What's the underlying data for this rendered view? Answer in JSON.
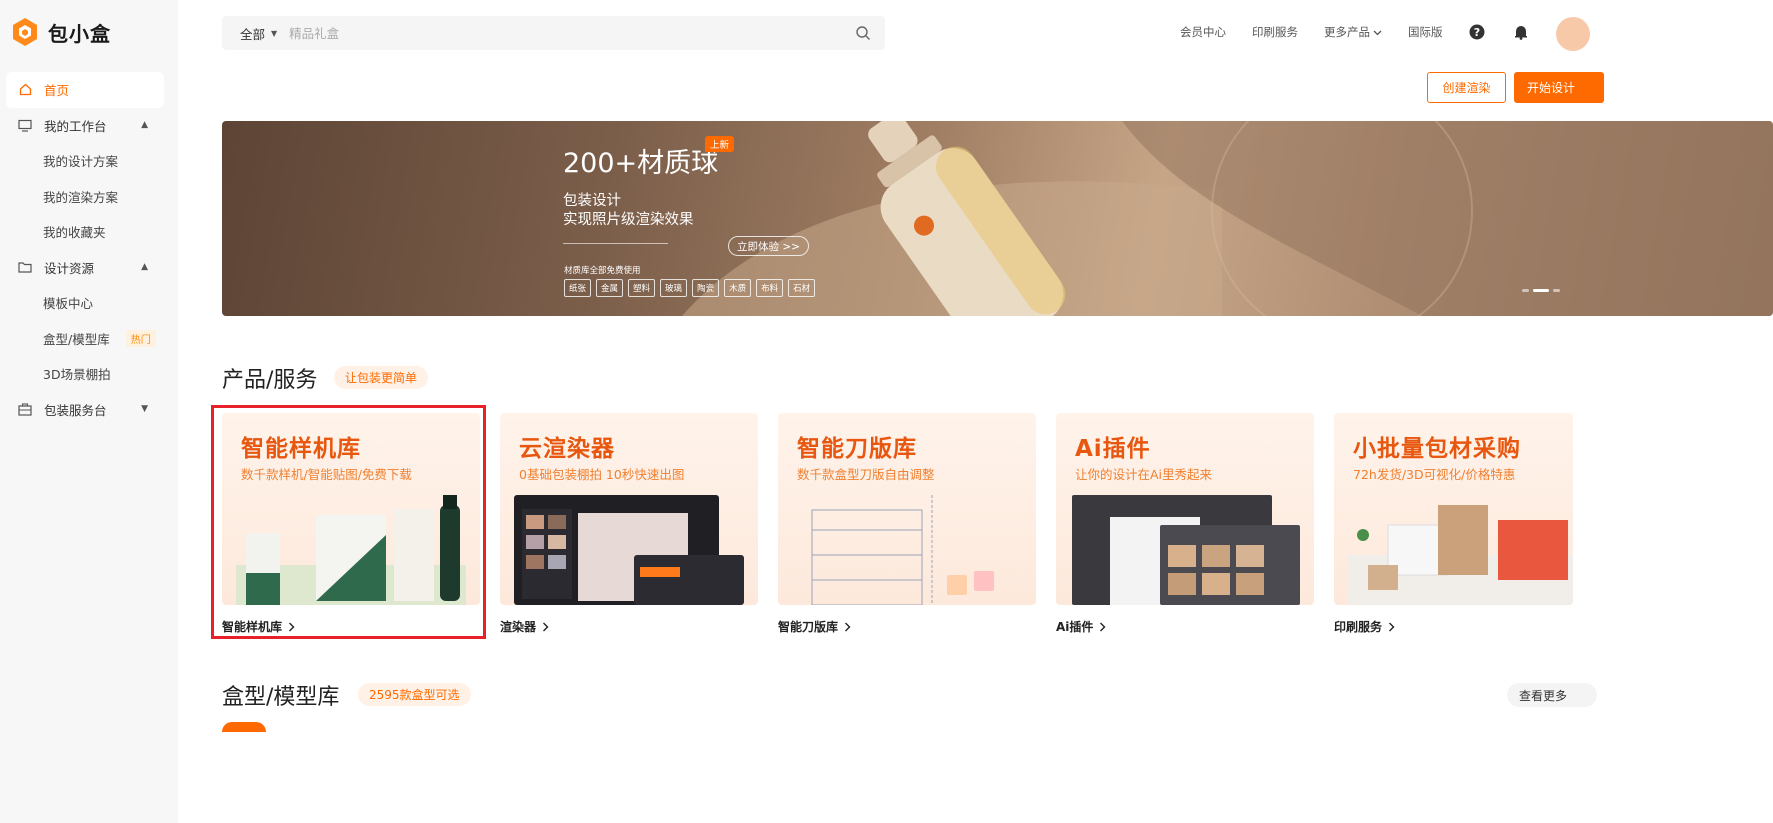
{
  "brand": {
    "name": "包小盒",
    "logo_icon": "box-logo-icon",
    "accent": "#ff6a00"
  },
  "sidebar": {
    "items": [
      {
        "label": "首页",
        "icon": "home-icon",
        "active": true
      },
      {
        "label": "我的工作台",
        "icon": "monitor-icon",
        "caret": "▲"
      },
      {
        "label": "我的设计方案"
      },
      {
        "label": "我的渲染方案"
      },
      {
        "label": "我的收藏夹"
      },
      {
        "label": "设计资源",
        "icon": "folder-icon",
        "caret": "▲"
      },
      {
        "label": "模板中心"
      },
      {
        "label": "盒型/模型库",
        "badge": "热门"
      },
      {
        "label": "3D场景棚拍"
      },
      {
        "label": "包装服务台",
        "icon": "briefcase-icon",
        "caret": "▼"
      }
    ]
  },
  "search": {
    "scope": "全部",
    "placeholder": "精品礼盒"
  },
  "topnav": {
    "member": "会员中心",
    "print": "印刷服务",
    "more": "更多产品",
    "intl": "国际版"
  },
  "actions": {
    "create_render": "创建渲染",
    "start_design": "开始设计"
  },
  "banner": {
    "title": "200+材质球",
    "badge": "上新",
    "line1": "包装设计",
    "line2": "实现照片级渲染效果",
    "cta": "立即体验 >>",
    "note": "材质库全部免费使用",
    "tags": [
      "纸张",
      "金属",
      "塑料",
      "玻璃",
      "陶瓷",
      "木质",
      "布料",
      "石材"
    ]
  },
  "products": {
    "title": "产品/服务",
    "tag": "让包装更简单",
    "cards": [
      {
        "title": "智能样机库",
        "subtitle": "数千款样机/智能贴图/免费下载",
        "link": "智能样机库"
      },
      {
        "title": "云渲染器",
        "subtitle": "0基础包装棚拍 10秒快速出图",
        "link": "渲染器"
      },
      {
        "title": "智能刀版库",
        "subtitle": "数千款盒型刀版自由调整",
        "link": "智能刀版库"
      },
      {
        "title": "Ai插件",
        "subtitle": "让你的设计在Ai里秀起来",
        "link": "Ai插件"
      },
      {
        "title": "小批量包材采购",
        "subtitle": "72h发货/3D可视化/价格特惠",
        "link": "印刷服务"
      }
    ]
  },
  "models": {
    "title": "盒型/模型库",
    "tag": "2595款盒型可选",
    "more": "查看更多"
  }
}
